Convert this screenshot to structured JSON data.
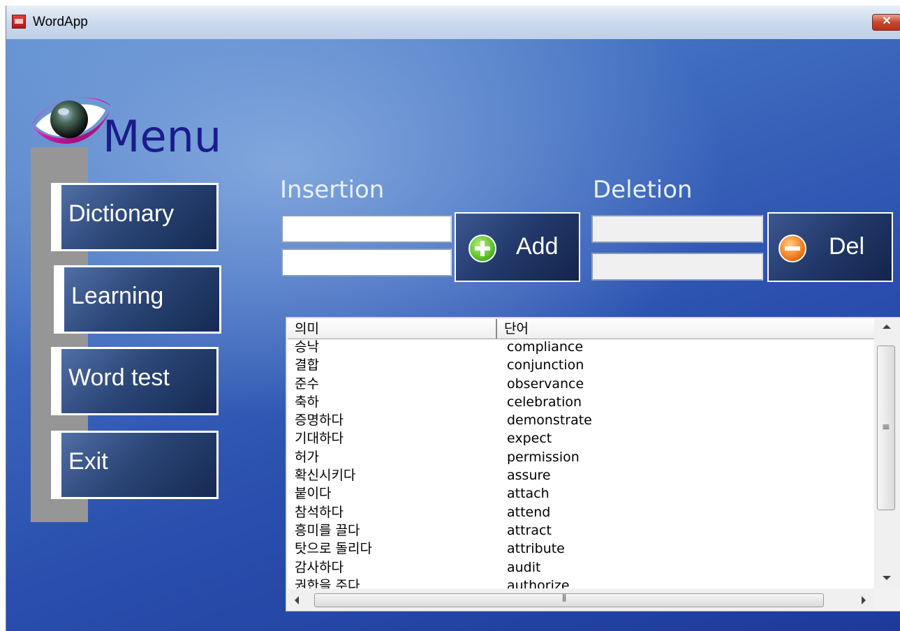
{
  "window": {
    "title": "WordApp",
    "close_label": "✕"
  },
  "menu": {
    "title": "Menu",
    "items": [
      {
        "label": "Dictionary"
      },
      {
        "label": "Learning"
      },
      {
        "label": "Word test"
      },
      {
        "label": "Exit"
      }
    ]
  },
  "insertion": {
    "label": "Insertion",
    "meaning_value": "",
    "word_value": "",
    "add_label": "Add",
    "add_icon": "plus-circle-icon"
  },
  "deletion": {
    "label": "Deletion",
    "meaning_value": "",
    "word_value": "",
    "del_label": "Del",
    "del_icon": "minus-circle-icon"
  },
  "word_list": {
    "columns": [
      "의미",
      "단어"
    ],
    "rows": [
      [
        "승낙",
        "compliance"
      ],
      [
        "결합",
        "conjunction"
      ],
      [
        "준수",
        "observance"
      ],
      [
        "축하",
        "celebration"
      ],
      [
        "증명하다",
        "demonstrate"
      ],
      [
        "기대하다",
        "expect"
      ],
      [
        "허가",
        "permission"
      ],
      [
        "확신시키다",
        "assure"
      ],
      [
        "붙이다",
        "attach"
      ],
      [
        "참석하다",
        "attend"
      ],
      [
        "흥미를 끌다",
        "attract"
      ],
      [
        "탓으로 돌리다",
        "attribute"
      ],
      [
        "감사하다",
        "audit"
      ],
      [
        "권한을 주다",
        "authorize"
      ]
    ]
  },
  "colors": {
    "background": "#1e3f9c",
    "menu_text": "#1a1c8c",
    "button_border": "#ffffff",
    "add_icon": "#5cbf2a",
    "del_icon": "#f07a1a"
  }
}
